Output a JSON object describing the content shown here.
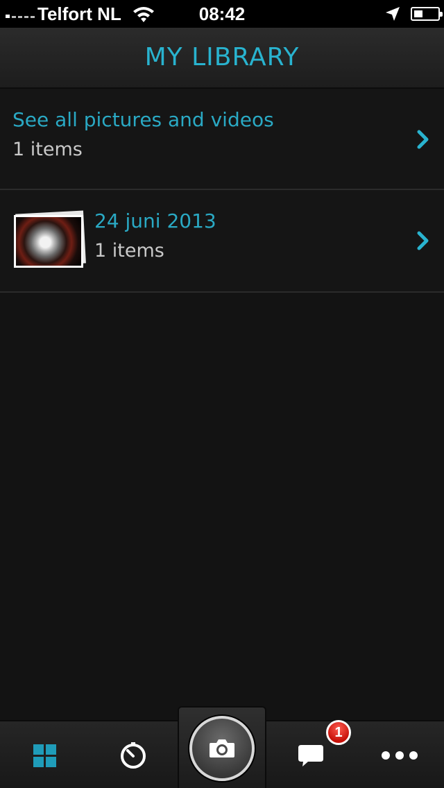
{
  "status_bar": {
    "carrier": "Telfort NL",
    "time": "08:42",
    "battery_level": 0.35
  },
  "navbar": {
    "title": "MY LIBRARY"
  },
  "library": {
    "rows": [
      {
        "title": "See all pictures and videos",
        "count": "1 items"
      },
      {
        "title": "24 juni 2013",
        "count": "1 items"
      }
    ]
  },
  "tabbar": {
    "tabs": [
      {
        "icon": "grid-icon",
        "active": true
      },
      {
        "icon": "timer-icon",
        "active": false
      },
      {
        "icon": "camera-icon",
        "active": false
      },
      {
        "icon": "chat-icon",
        "active": false,
        "badge": "1"
      },
      {
        "icon": "more-icon",
        "active": false
      }
    ]
  },
  "colors": {
    "accent": "#29b3cf",
    "background": "#131313",
    "badge": "#d3170e"
  }
}
